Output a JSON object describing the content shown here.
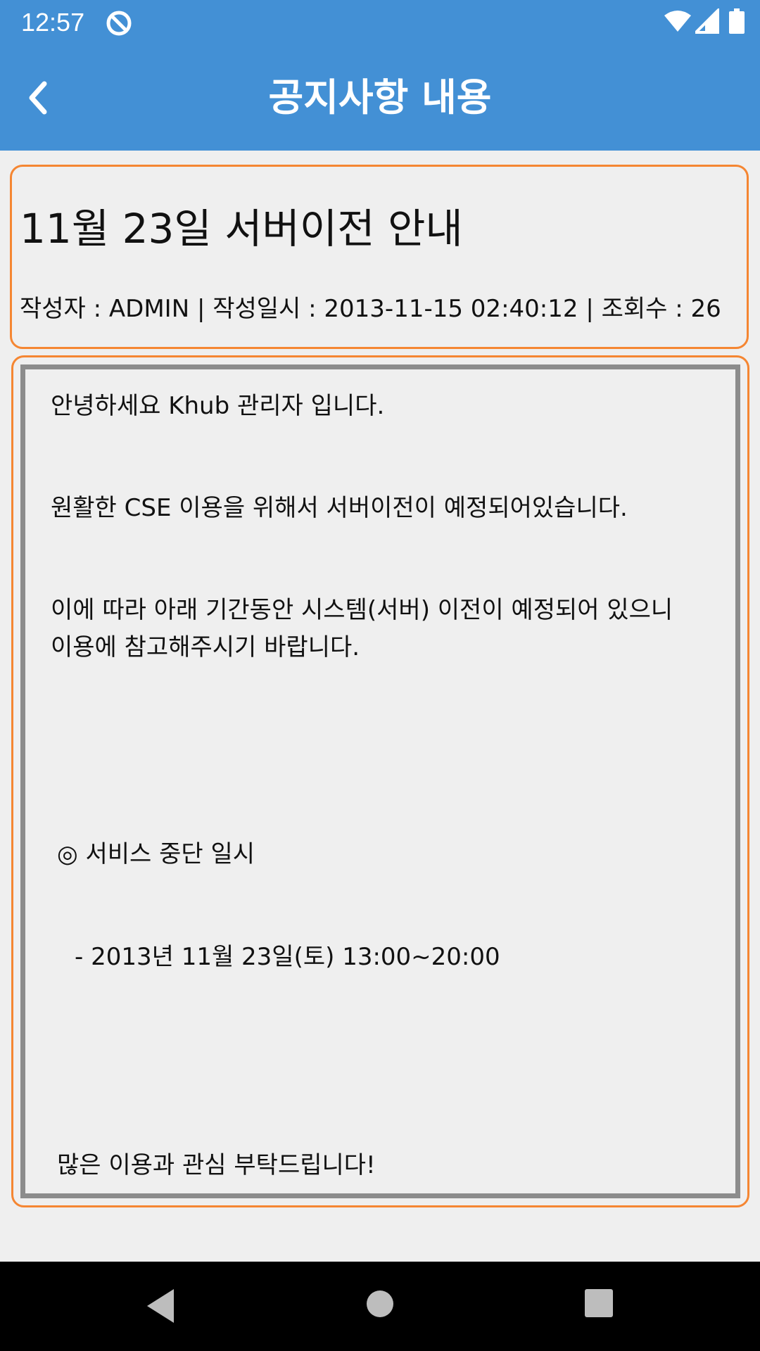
{
  "status_bar": {
    "time": "12:57",
    "icons": [
      "app-notification-icon",
      "wifi-icon",
      "signal-icon",
      "battery-icon"
    ]
  },
  "app_bar": {
    "title": "공지사항 내용",
    "back_icon": "chevron-left-icon",
    "color": "#4390d5"
  },
  "notice": {
    "title": "11월 23일 서버이전 안내",
    "meta": "작성자 : ADMIN | 작성일시 : 2013-11-15 02:40:12 | 조회수 : 26"
  },
  "content": {
    "greeting": "안녕하세요 Khub 관리자 입니다.",
    "line2": "원활한 CSE 이용을 위해서 서버이전이 예정되어있습니다.",
    "line3a": "이에 따라 아래 기간동안 시스템(서버) 이전이 예정되어 있으니",
    "line3b": "이용에 참고해주시기 바랍니다.",
    "section_heading": "◎ 서비스 중단 일시",
    "schedule": "- 2013년 11월 23일(토) 13:00~20:00",
    "closing": "많은 이용과 관심 부탁드립니다!"
  },
  "nav_bar": {
    "buttons": [
      "back-triangle-icon",
      "home-circle-icon",
      "recents-square-icon"
    ]
  }
}
